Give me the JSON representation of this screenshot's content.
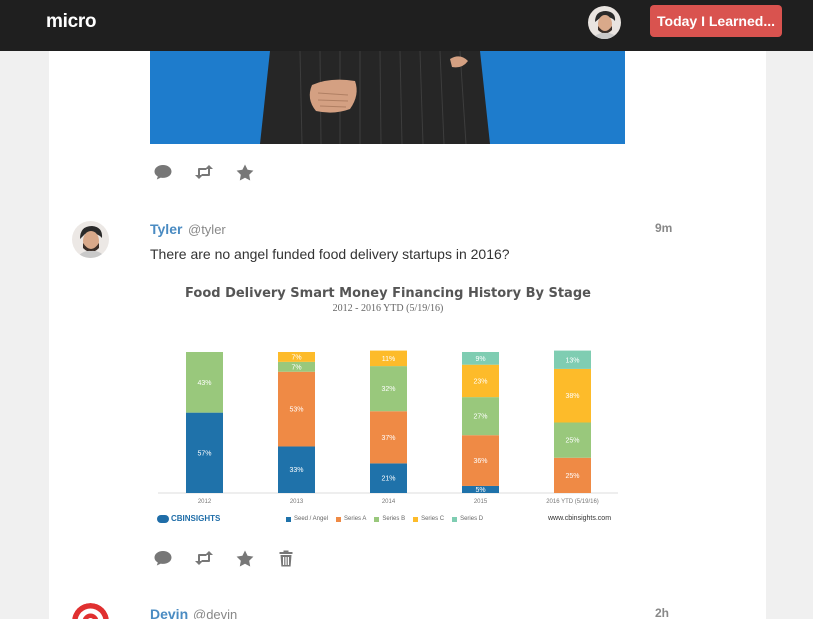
{
  "topbar": {
    "brand": "micro",
    "cta_label": "Today I Learned..."
  },
  "posts": [
    {
      "name": "Tyler",
      "username": "@tyler",
      "time": "9m",
      "text": "There are no angel funded food delivery startups in 2016?"
    },
    {
      "name": "Devin",
      "username": "@devin",
      "time": "2h"
    }
  ],
  "chart_data": {
    "type": "bar",
    "stacked": true,
    "title": "Food Delivery Smart Money Financing History By Stage",
    "subtitle": "2012 - 2016 YTD (5/19/16)",
    "categories": [
      "2012",
      "2013",
      "2014",
      "2015",
      "2016 YTD (5/19/16)"
    ],
    "series": [
      {
        "name": "Seed / Angel",
        "color": "#1f72aa",
        "values": [
          57,
          33,
          21,
          5,
          0
        ]
      },
      {
        "name": "Series A",
        "color": "#ef8a45",
        "values": [
          0,
          53,
          37,
          36,
          25
        ]
      },
      {
        "name": "Series B",
        "color": "#99c87c",
        "values": [
          43,
          7,
          32,
          27,
          25
        ]
      },
      {
        "name": "Series C",
        "color": "#fdbb2a",
        "values": [
          0,
          7,
          11,
          23,
          38
        ]
      },
      {
        "name": "Series D",
        "color": "#7fcdb2",
        "values": [
          0,
          0,
          0,
          9,
          13
        ]
      }
    ],
    "ylim": [
      0,
      100
    ],
    "source": "www.cbinsights.com",
    "logo": "CBINSIGHTS"
  }
}
